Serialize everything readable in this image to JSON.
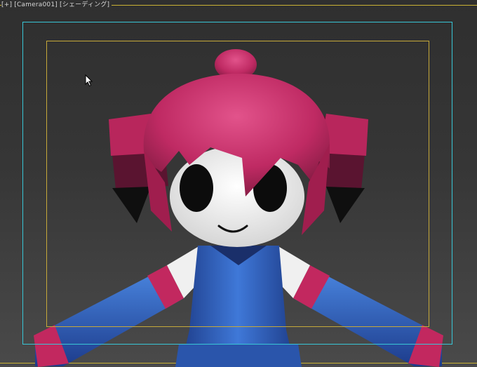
{
  "viewport": {
    "label_segments": [
      "[+]",
      "[Camera001]",
      "[シェーディング]"
    ],
    "colors": {
      "safe_frame_outer": "#38c6d6",
      "safe_frame_inner": "#c6a93a",
      "border": "#c9b234",
      "hair": "#c2285f",
      "dress": "#2f5fb8",
      "skin": "#f2f2f2"
    }
  },
  "cursor": {
    "icon": "arrow-cursor-icon"
  }
}
